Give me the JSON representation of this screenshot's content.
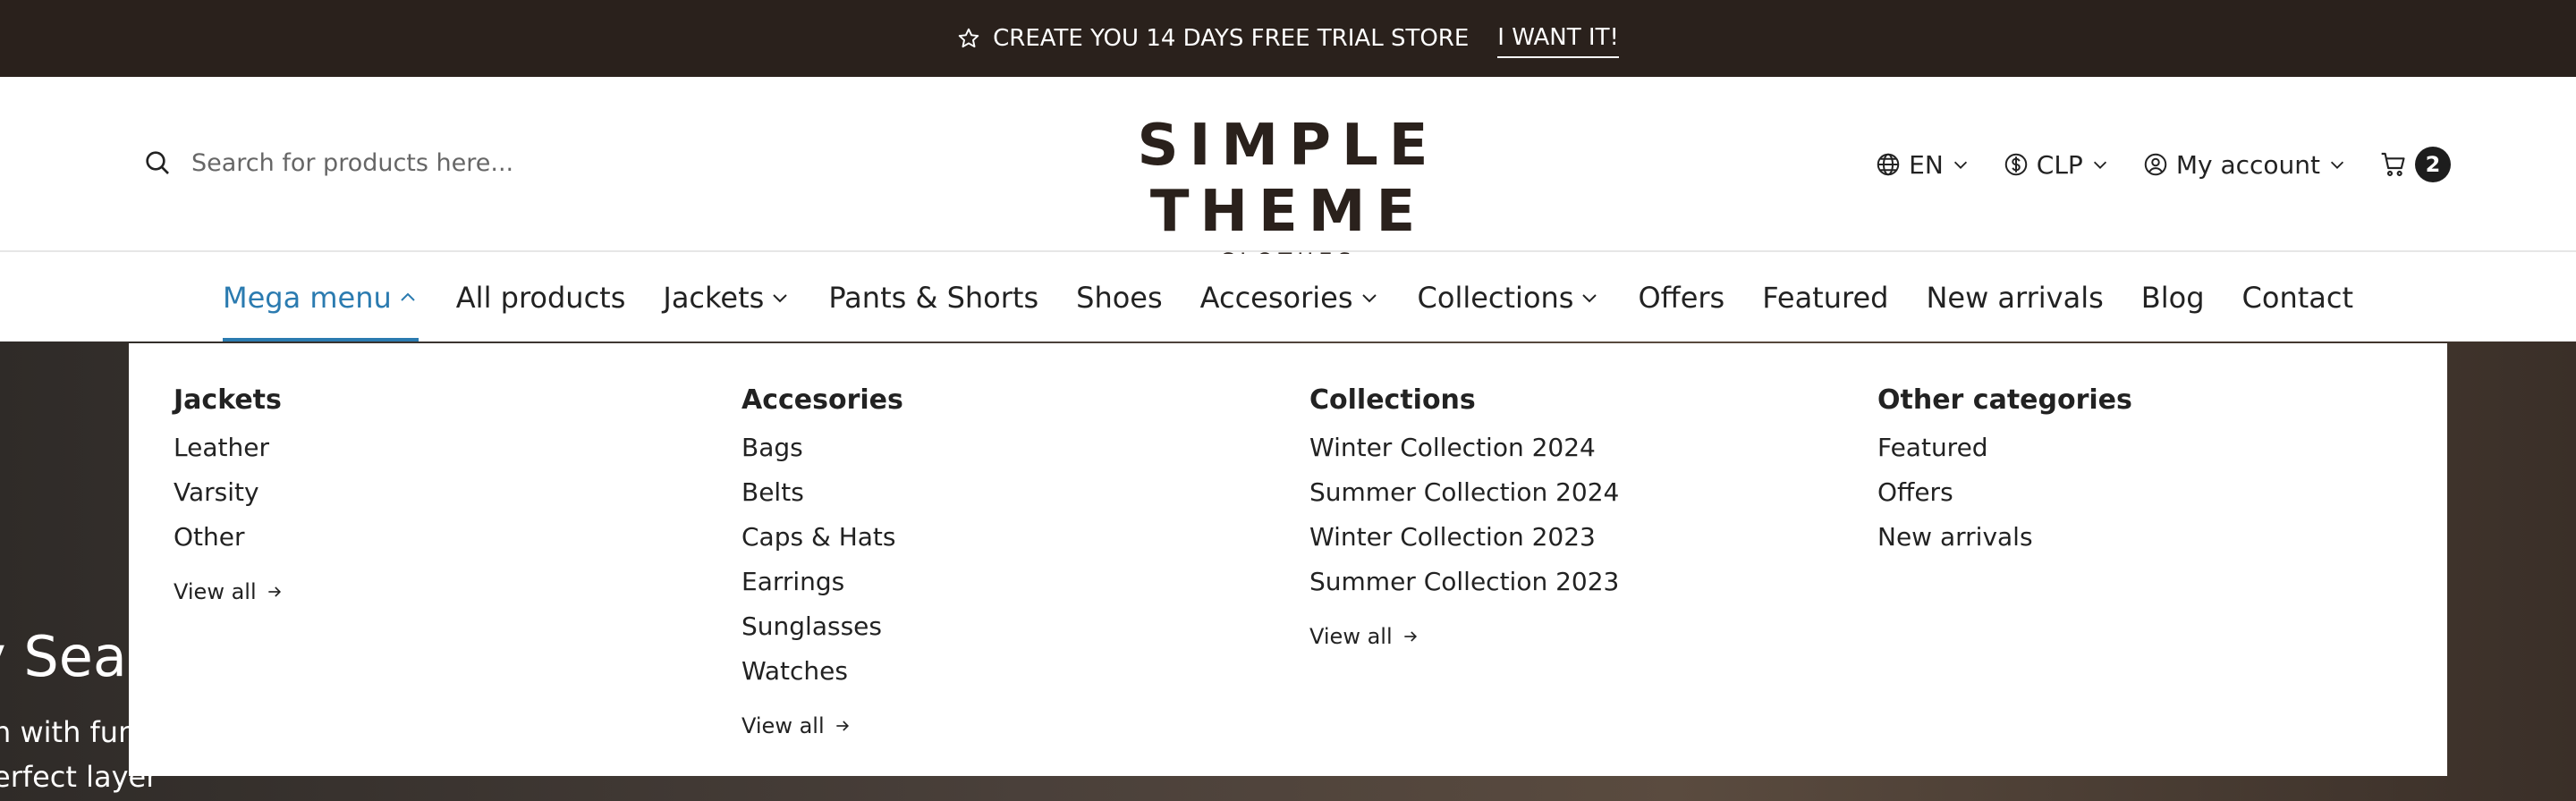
{
  "announcement": {
    "text": "CREATE YOU 14 DAYS FREE TRIAL STORE",
    "cta": "I WANT IT!",
    "icon": "star-icon"
  },
  "search": {
    "placeholder": "Search for products here...",
    "icon": "search-icon"
  },
  "logo": {
    "brand": "SIMPLE THEME",
    "sub": "– CLOTHES –"
  },
  "utilities": {
    "language": "EN",
    "currency": "CLP",
    "account": "My account",
    "cart_count": "2"
  },
  "nav": {
    "items": [
      {
        "label": "Mega menu",
        "has_dropdown": true,
        "active": true
      },
      {
        "label": "All products"
      },
      {
        "label": "Jackets",
        "has_dropdown": true
      },
      {
        "label": "Pants & Shorts"
      },
      {
        "label": "Shoes"
      },
      {
        "label": "Accesories",
        "has_dropdown": true
      },
      {
        "label": "Collections",
        "has_dropdown": true
      },
      {
        "label": "Offers"
      },
      {
        "label": "Featured"
      },
      {
        "label": "New arrivals"
      },
      {
        "label": "Blog"
      },
      {
        "label": "Contact"
      }
    ]
  },
  "mega_menu": {
    "columns": [
      {
        "title": "Jackets",
        "links": [
          "Leather",
          "Varsity",
          "Other"
        ],
        "view_all": "View all"
      },
      {
        "title": "Accesories",
        "links": [
          "Bags",
          "Belts",
          "Caps & Hats",
          "Earrings",
          "Sunglasses",
          "Watches"
        ],
        "view_all": "View all"
      },
      {
        "title": "Collections",
        "links": [
          "Winter Collection 2024",
          "Summer Collection 2024",
          "Winter Collection 2023",
          "Summer Collection 2023"
        ],
        "view_all": "View all"
      },
      {
        "title": "Other categories",
        "links": [
          "Featured",
          "Offers",
          "New arrivals"
        ]
      }
    ]
  },
  "hero": {
    "heading": "y Seas",
    "line1": "n with fun",
    "line2": "erfect layer"
  },
  "colors": {
    "topbar_bg": "#2a211c",
    "accent": "#2b7bb0",
    "text": "#222222"
  }
}
